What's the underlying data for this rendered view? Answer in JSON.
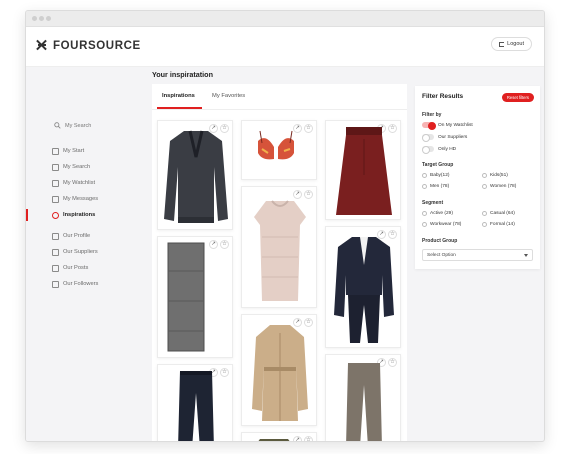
{
  "brand": {
    "name": "FOURSOURCE",
    "accent": "#e02020"
  },
  "header": {
    "logout_label": "Logout"
  },
  "sidebar": {
    "search_label": "My Search",
    "items": [
      {
        "label": "My Start",
        "icon": "home-icon"
      },
      {
        "label": "My Search",
        "icon": "search-icon"
      },
      {
        "label": "My Watchlist",
        "icon": "bookmark-icon"
      },
      {
        "label": "My Messages",
        "icon": "message-icon"
      },
      {
        "label": "Inspirations",
        "icon": "star-icon",
        "active": true
      },
      {
        "label": "Our Profile",
        "icon": "profile-icon"
      },
      {
        "label": "Our Suppliers",
        "icon": "suppliers-icon"
      },
      {
        "label": "Our Posts",
        "icon": "posts-icon"
      },
      {
        "label": "Our Followers",
        "icon": "followers-icon"
      }
    ]
  },
  "main": {
    "title": "Your inspiratation",
    "tabs": [
      {
        "label": "Inspirations",
        "active": true
      },
      {
        "label": "My Favorites",
        "active": false
      }
    ],
    "cards": [
      {
        "item": "knit-sweater",
        "color": "#3a3d44"
      },
      {
        "item": "bikini-top",
        "color": "#d6533a"
      },
      {
        "item": "skirt",
        "color": "#7a1f1f"
      },
      {
        "item": "lace-top",
        "color": "#e4cfc6"
      },
      {
        "item": "scarf",
        "color": "#6f6f6f"
      },
      {
        "item": "suit",
        "color": "#23283a"
      },
      {
        "item": "jeans",
        "color": "#1e2433"
      },
      {
        "item": "trench-coat",
        "color": "#cbae89"
      },
      {
        "item": "trousers",
        "color": "#7d7469"
      },
      {
        "item": "olive-jacket",
        "color": "#5b5a3e"
      }
    ]
  },
  "filter": {
    "title": "Filter Results",
    "reset_label": "Reset filters",
    "filter_by_label": "Filter by",
    "toggles": [
      {
        "label": "On My Watchlist",
        "on": true
      },
      {
        "label": "Our Suppliers",
        "on": false
      },
      {
        "label": "Only HD",
        "on": false
      }
    ],
    "target_group_label": "Target Group",
    "target_groups": [
      "Baby(12)",
      "Kids(51)",
      "Men (78)",
      "Women (78)"
    ],
    "segment_label": "Segment",
    "segments": [
      "Active (29)",
      "Casual (64)",
      "Workwear (78)",
      "Formal (14)"
    ],
    "product_group_label": "Product Group",
    "product_group_placeholder": "Select Option"
  }
}
